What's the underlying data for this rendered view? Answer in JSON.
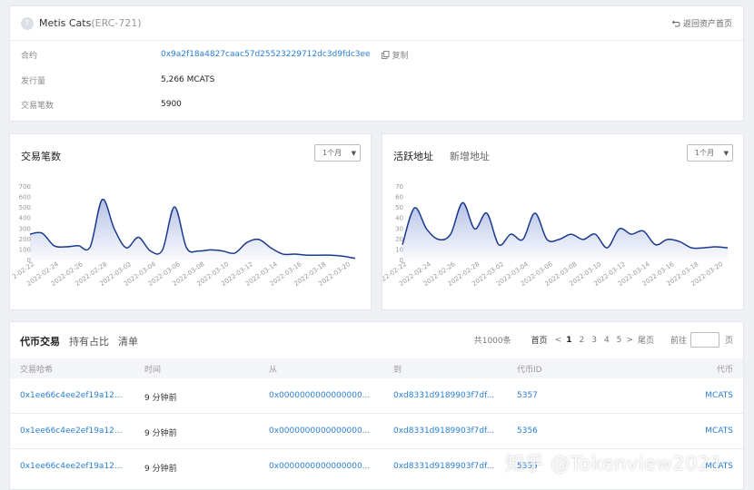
{
  "token": {
    "logo_letter": "T",
    "name": "Metis Cats",
    "standard": "(ERC-721)",
    "back_label": "返回资产首页",
    "contract_label": "合约",
    "contract_address": "0x9a2f18a4827caac57d25523229712dc3d9fdc3ee",
    "copy_label": "复制",
    "supply_label": "发行量",
    "supply_value": "5,266 MCATS",
    "tx_count_label": "交易笔数",
    "tx_count_value": "5900"
  },
  "charts": {
    "left_title": "交易笔数",
    "right_title": "活跃地址",
    "right_tab2": "新增地址",
    "period_label": "1个月",
    "line_color": "#1a3a8f"
  },
  "chart_data": [
    {
      "type": "area",
      "title": "交易笔数",
      "x": [
        "2022-02-22",
        "2022-02-23",
        "2022-02-24",
        "2022-02-25",
        "2022-02-26",
        "2022-02-27",
        "2022-02-28",
        "2022-03-01",
        "2022-03-02",
        "2022-03-03",
        "2022-03-04",
        "2022-03-05",
        "2022-03-06",
        "2022-03-07",
        "2022-03-08",
        "2022-03-09",
        "2022-03-10",
        "2022-03-11",
        "2022-03-12",
        "2022-03-13",
        "2022-03-14",
        "2022-03-15",
        "2022-03-16",
        "2022-03-17",
        "2022-03-18",
        "2022-03-19",
        "2022-03-20",
        "2022-03-21"
      ],
      "xticks": [
        "2-02-22",
        "2022-02-24",
        "2022-02-26",
        "2022-02-28",
        "2022-03-02",
        "2022-03-04",
        "2022-03-06",
        "2022-03-08",
        "2022-03-10",
        "2022-03-12",
        "2022-03-14",
        "2022-03-16",
        "2022-03-18",
        "2022-03-20"
      ],
      "y": [
        250,
        260,
        140,
        130,
        140,
        130,
        580,
        300,
        120,
        220,
        90,
        100,
        510,
        120,
        90,
        100,
        90,
        70,
        170,
        200,
        120,
        60,
        60,
        50,
        50,
        50,
        40,
        20
      ],
      "ylim": [
        0,
        700
      ],
      "yticks": [
        "700",
        "600",
        "500",
        "400",
        "300",
        "200",
        "100",
        "0"
      ]
    },
    {
      "type": "area",
      "title": "活跃地址",
      "x": [
        "2022-02-22",
        "2022-02-23",
        "2022-02-24",
        "2022-02-25",
        "2022-02-26",
        "2022-02-27",
        "2022-02-28",
        "2022-03-01",
        "2022-03-02",
        "2022-03-03",
        "2022-03-04",
        "2022-03-05",
        "2022-03-06",
        "2022-03-07",
        "2022-03-08",
        "2022-03-09",
        "2022-03-10",
        "2022-03-11",
        "2022-03-12",
        "2022-03-13",
        "2022-03-14",
        "2022-03-15",
        "2022-03-16",
        "2022-03-17",
        "2022-03-18",
        "2022-03-19",
        "2022-03-20",
        "2022-03-21"
      ],
      "xticks": [
        "2022-02-22",
        "2022-02-24",
        "2022-02-26",
        "2022-02-28",
        "2022-03-02",
        "2022-03-04",
        "2022-03-06",
        "2022-03-08",
        "2022-03-10",
        "2022-03-12",
        "2022-03-14",
        "2022-03-16",
        "2022-03-18",
        "2022-03-20"
      ],
      "y": [
        15,
        50,
        30,
        20,
        25,
        55,
        30,
        45,
        15,
        25,
        20,
        45,
        20,
        20,
        25,
        20,
        25,
        12,
        30,
        25,
        28,
        15,
        20,
        18,
        12,
        12,
        13,
        12
      ],
      "ylim": [
        0,
        70
      ],
      "yticks": [
        "70",
        "60",
        "50",
        "40",
        "30",
        "20",
        "10",
        "0"
      ]
    }
  ],
  "table": {
    "tabs": [
      "代币交易",
      "持有占比",
      "清单"
    ],
    "total": "共1000条",
    "first_label": "首页",
    "prev": "<",
    "pages": [
      "1",
      "2",
      "3",
      "4",
      "5"
    ],
    "next": ">",
    "last_label": "尾页",
    "goto_label": "前往",
    "page_unit": "页",
    "headers": [
      "交易哈希",
      "时间",
      "从",
      "到",
      "代币ID",
      "代币"
    ],
    "rows": [
      {
        "hash": "0x1ee66c4ee2ef19a12...",
        "time": "9 分钟前",
        "from": "0x0000000000000000...",
        "to": "0xd8331d9189903f7df...",
        "token_id": "5357",
        "token": "MCATS"
      },
      {
        "hash": "0x1ee66c4ee2ef19a12...",
        "time": "9 分钟前",
        "from": "0x0000000000000000...",
        "to": "0xd8331d9189903f7df...",
        "token_id": "5356",
        "token": "MCATS"
      },
      {
        "hash": "0x1ee66c4ee2ef19a12...",
        "time": "9 分钟前",
        "from": "0x0000000000000000...",
        "to": "0xd8331d9189903f7df...",
        "token_id": "5355",
        "token": "MCATS"
      }
    ]
  },
  "watermark": "知乎 @Tokenview2021"
}
